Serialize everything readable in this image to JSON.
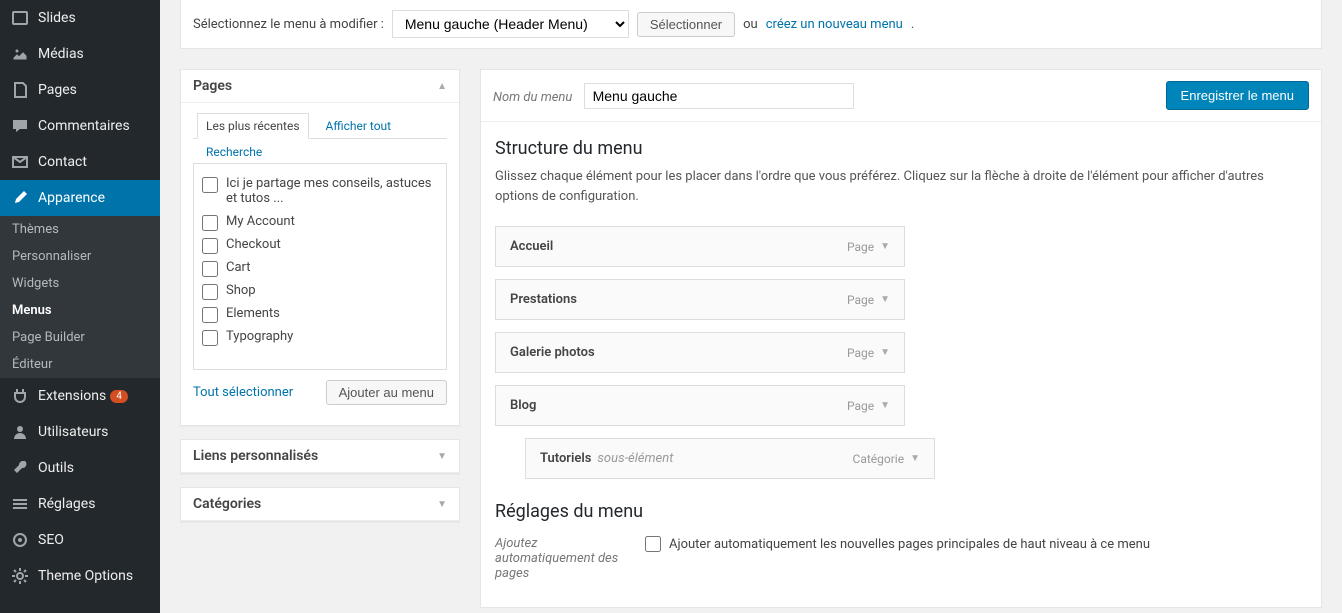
{
  "sidebar": {
    "items": [
      {
        "label": "Slides",
        "icon": "slides"
      },
      {
        "label": "Médias",
        "icon": "media"
      },
      {
        "label": "Pages",
        "icon": "page"
      },
      {
        "label": "Commentaires",
        "icon": "comment"
      },
      {
        "label": "Contact",
        "icon": "mail"
      },
      {
        "label": "Apparence",
        "icon": "brush",
        "current": true
      },
      {
        "label": "Extensions",
        "icon": "plugin",
        "badge": "4"
      },
      {
        "label": "Utilisateurs",
        "icon": "users"
      },
      {
        "label": "Outils",
        "icon": "tools"
      },
      {
        "label": "Réglages",
        "icon": "settings"
      },
      {
        "label": "SEO",
        "icon": "seo"
      },
      {
        "label": "Theme Options",
        "icon": "gear"
      }
    ],
    "submenu": [
      {
        "label": "Thèmes"
      },
      {
        "label": "Personnaliser"
      },
      {
        "label": "Widgets"
      },
      {
        "label": "Menus",
        "current": true
      },
      {
        "label": "Page Builder"
      },
      {
        "label": "Éditeur"
      }
    ]
  },
  "topbar": {
    "label": "Sélectionnez le menu à modifier :",
    "select_value": "Menu gauche (Header Menu)",
    "button": "Sélectionner",
    "or": "ou",
    "create_link": "créez un nouveau menu"
  },
  "pages_box": {
    "title": "Pages",
    "tabs": {
      "recent": "Les plus récentes",
      "all": "Afficher tout",
      "search": "Recherche"
    },
    "items": [
      "Ici je partage mes conseils, astuces et tutos ...",
      "My Account",
      "Checkout",
      "Cart",
      "Shop",
      "Elements",
      "Typography"
    ],
    "select_all": "Tout sélectionner",
    "add_button": "Ajouter au menu"
  },
  "links_box": {
    "title": "Liens personnalisés"
  },
  "cats_box": {
    "title": "Catégories"
  },
  "menu": {
    "name_label": "Nom du menu",
    "name_value": "Menu gauche",
    "save_button": "Enregistrer le menu",
    "structure_title": "Structure du menu",
    "structure_hint": "Glissez chaque élément pour les placer dans l'ordre que vous préférez. Cliquez sur la flèche à droite de l'élément pour afficher d'autres options de configuration.",
    "items": [
      {
        "title": "Accueil",
        "type": "Page"
      },
      {
        "title": "Prestations",
        "type": "Page"
      },
      {
        "title": "Galerie photos",
        "type": "Page"
      },
      {
        "title": "Blog",
        "type": "Page"
      },
      {
        "title": "Tutoriels",
        "type": "Catégorie",
        "sub": true,
        "sub_hint": "sous-élément"
      }
    ],
    "settings_title": "Réglages du menu",
    "setting_auto_label": "Ajoutez automatiquement des pages",
    "setting_auto_checkbox": "Ajouter automatiquement les nouvelles pages principales de haut niveau à ce menu"
  }
}
